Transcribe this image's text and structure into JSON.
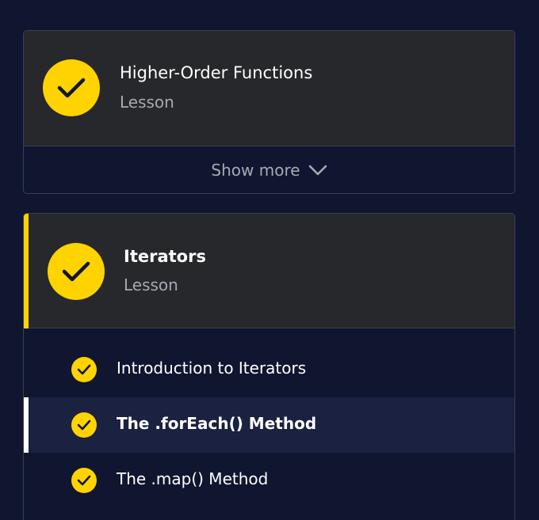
{
  "lessons": [
    {
      "title": "Higher-Order Functions",
      "type": "Lesson",
      "show_more_label": "Show more"
    },
    {
      "title": "Iterators",
      "type": "Lesson",
      "items": [
        {
          "label": "Introduction to Iterators",
          "completed": true,
          "active": false
        },
        {
          "label": "The .forEach() Method",
          "completed": true,
          "active": true
        },
        {
          "label": "The .map() Method",
          "completed": true,
          "active": false
        }
      ]
    }
  ],
  "colors": {
    "background": "#10162f",
    "card": "#27282c",
    "accent": "#ffd300",
    "active_row": "#1b2140"
  }
}
